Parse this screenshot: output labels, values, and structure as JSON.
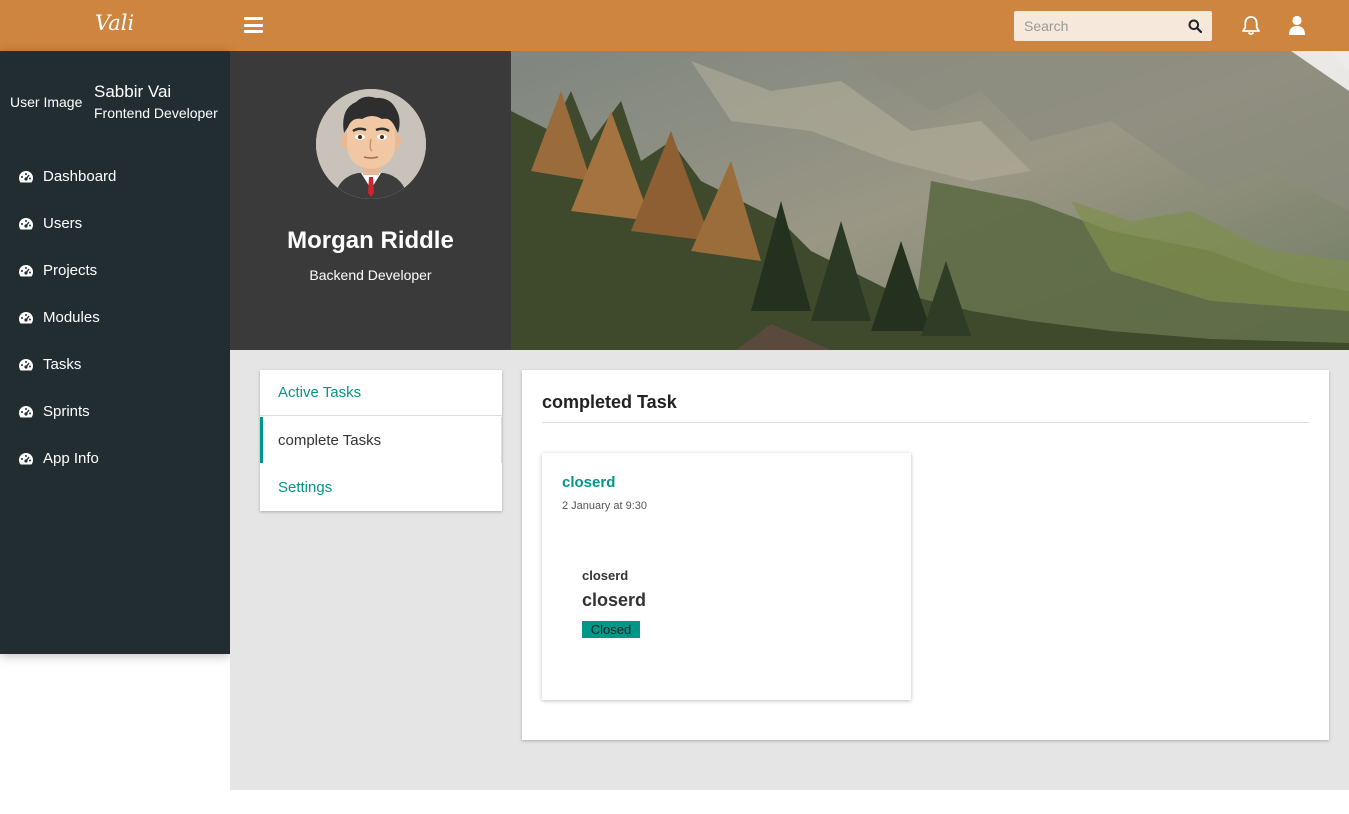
{
  "header": {
    "brand": "Vali",
    "search_placeholder": "Search"
  },
  "sidebar": {
    "user_image_alt": "User Image",
    "user_name": "Sabbir Vai",
    "user_role": "Frontend Developer",
    "items": [
      {
        "label": "Dashboard",
        "icon": "dashboard-icon"
      },
      {
        "label": "Users",
        "icon": "dashboard-icon"
      },
      {
        "label": "Projects",
        "icon": "dashboard-icon"
      },
      {
        "label": "Modules",
        "icon": "dashboard-icon"
      },
      {
        "label": "Tasks",
        "icon": "dashboard-icon"
      },
      {
        "label": "Sprints",
        "icon": "dashboard-icon"
      },
      {
        "label": "App Info",
        "icon": "dashboard-icon"
      }
    ]
  },
  "profile": {
    "name": "Morgan Riddle",
    "role": "Backend Developer"
  },
  "tabs": [
    {
      "label": "Active Tasks"
    },
    {
      "label": "complete Tasks",
      "active": true
    },
    {
      "label": "Settings"
    }
  ],
  "main": {
    "title": "completed Task",
    "task": {
      "heading": "closerd",
      "date": "2 January at 9:30",
      "subtitle": "closerd",
      "title": "closerd",
      "status": "Closed"
    }
  },
  "colors": {
    "header": "#cd853f",
    "sidebar": "#222d32",
    "accent": "#009688",
    "profile_bg": "#3a3a3a",
    "content_bg": "#e5e5e5"
  }
}
